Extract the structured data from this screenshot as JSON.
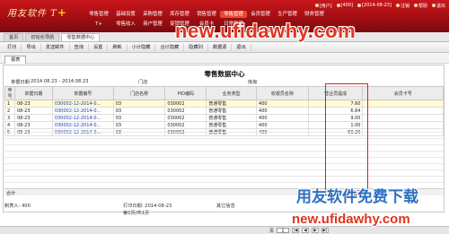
{
  "app": {
    "logo_text": "用友软件 T",
    "logo_accent": "+",
    "topbar": [
      "[用户]",
      "[400]",
      "[2014-08-23]",
      "注销",
      "帮助",
      "退出"
    ],
    "menu_row1": [
      "零售管理",
      "基础设置",
      "采购管理",
      "库存管理",
      "销售管理",
      "零售管理",
      "会员管理",
      "生产管理",
      "财务管理"
    ],
    "menu_row2": [
      "T+",
      "零售收入",
      "商户管理",
      "促销管理",
      "会员卡",
      "日常管理"
    ]
  },
  "tabs": [
    "首页",
    "初始化导航",
    "零售数据中心"
  ],
  "toolbar": [
    "打印",
    "导出",
    "发送邮件",
    "查询",
    "设置",
    "刷新",
    "小计隐藏",
    "合计隐藏",
    "隐藏列",
    "数据源",
    "退出"
  ],
  "report_tab": "报表",
  "report": {
    "title": "零售数据中心",
    "date_label": "单据日期",
    "date_value": "2014.08.23 - 2014.08.23",
    "store_label": "门店",
    "store_value": "",
    "warehouse_label": "库房",
    "columns": [
      "序号",
      "单据日期",
      "单据编号",
      "门店名称",
      "PID编码",
      "业务类型",
      "收银员名称",
      "营业员提成",
      "会员卡号"
    ],
    "rows": [
      {
        "seq": "1",
        "date": "08-23",
        "code": "030002-12-2014-0...",
        "store": "03",
        "pid": "030002",
        "type": "普通零售",
        "cashier": "400",
        "amount": "7.60",
        "card": ""
      },
      {
        "seq": "2",
        "date": "08-23",
        "code": "030002-12-2014-0...",
        "store": "03",
        "pid": "030002",
        "type": "普通零售",
        "cashier": "400",
        "amount": "6.84",
        "card": ""
      },
      {
        "seq": "3",
        "date": "08-23",
        "code": "030002-12-2014-0...",
        "store": "03",
        "pid": "030002",
        "type": "普通零售",
        "cashier": "400",
        "amount": "9.00",
        "card": ""
      },
      {
        "seq": "4",
        "date": "08-23",
        "code": "030002-12-2014-0...",
        "store": "03",
        "pid": "030002",
        "type": "普通零售",
        "cashier": "400",
        "amount": "1.00",
        "card": ""
      },
      {
        "seq": "5",
        "date": "08-23",
        "code": "030002-12-2014-0...",
        "store": "03",
        "pid": "030002",
        "type": "普通零售",
        "cashier": "400",
        "amount": "60.20",
        "card": ""
      }
    ],
    "total_label": "合计",
    "total_value": "84.73"
  },
  "footer": {
    "maker_label": "制表人:",
    "maker_value": "400",
    "print_time_label": "打印日期:",
    "print_time_value": "2014-08-23",
    "other_label": "其它信息",
    "page_info": "第1页/共1页"
  },
  "status": {
    "page_label": "页",
    "page_value": "1"
  },
  "watermarks": {
    "top": "new.ufidawhy.com",
    "bottom_cn": "用友软件免费下载",
    "bottom_url": "new.ufidawhy.com"
  },
  "colors": {
    "header": "#b01016",
    "highlight_box": "#e21b1b",
    "watermark_red": "#e0341f",
    "watermark_blue": "#2b6fc2"
  }
}
